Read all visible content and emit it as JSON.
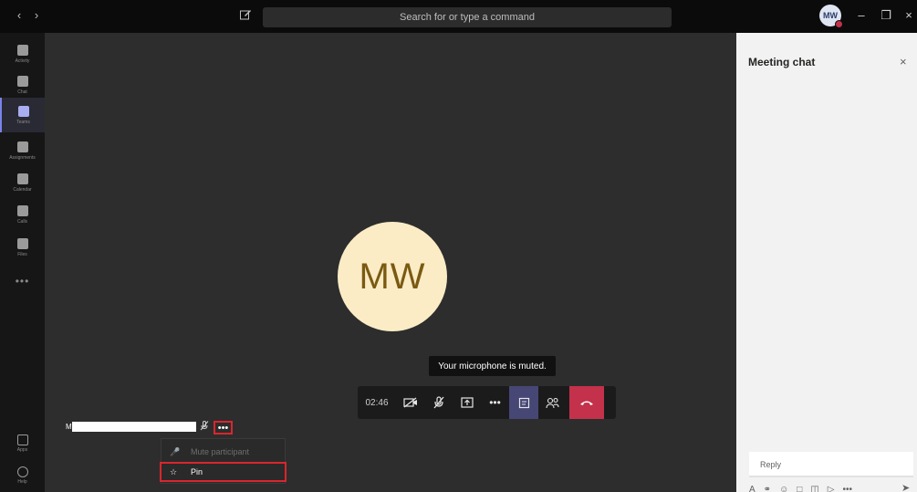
{
  "titlebar": {
    "back_icon": "chevron-left",
    "forward_icon": "chevron-right",
    "compose_icon": "compose",
    "search_placeholder": "Search for or type a command",
    "avatar_initials": "MW",
    "minimize_icon": "minimize",
    "restore_icon": "restore",
    "close_icon": "close"
  },
  "rail": {
    "items": [
      {
        "label": "Activity",
        "icon": "bell"
      },
      {
        "label": "Chat",
        "icon": "chat"
      },
      {
        "label": "Teams",
        "icon": "teams",
        "active": true
      },
      {
        "label": "Assignments",
        "icon": "assignments"
      },
      {
        "label": "Calendar",
        "icon": "calendar"
      },
      {
        "label": "Calls",
        "icon": "phone"
      },
      {
        "label": "Files",
        "icon": "file"
      }
    ],
    "more_label": "•••",
    "apps_label": "Apps",
    "help_label": "Help"
  },
  "stage": {
    "avatar_initials": "MW",
    "toast": "Your microphone is muted.",
    "timer": "02:46",
    "participant_initial": "M",
    "participant_more": "•••",
    "menu": {
      "mute_label": "Mute participant",
      "pin_label": "Pin"
    }
  },
  "chat": {
    "title": "Meeting chat",
    "close_icon": "close",
    "reply_placeholder": "Reply",
    "more_tools": "•••"
  },
  "colors": {
    "accent": "#7b83eb",
    "hangup": "#c4314b",
    "highlight_outline": "#d9262e",
    "avatar_bg": "#fbecc6"
  }
}
